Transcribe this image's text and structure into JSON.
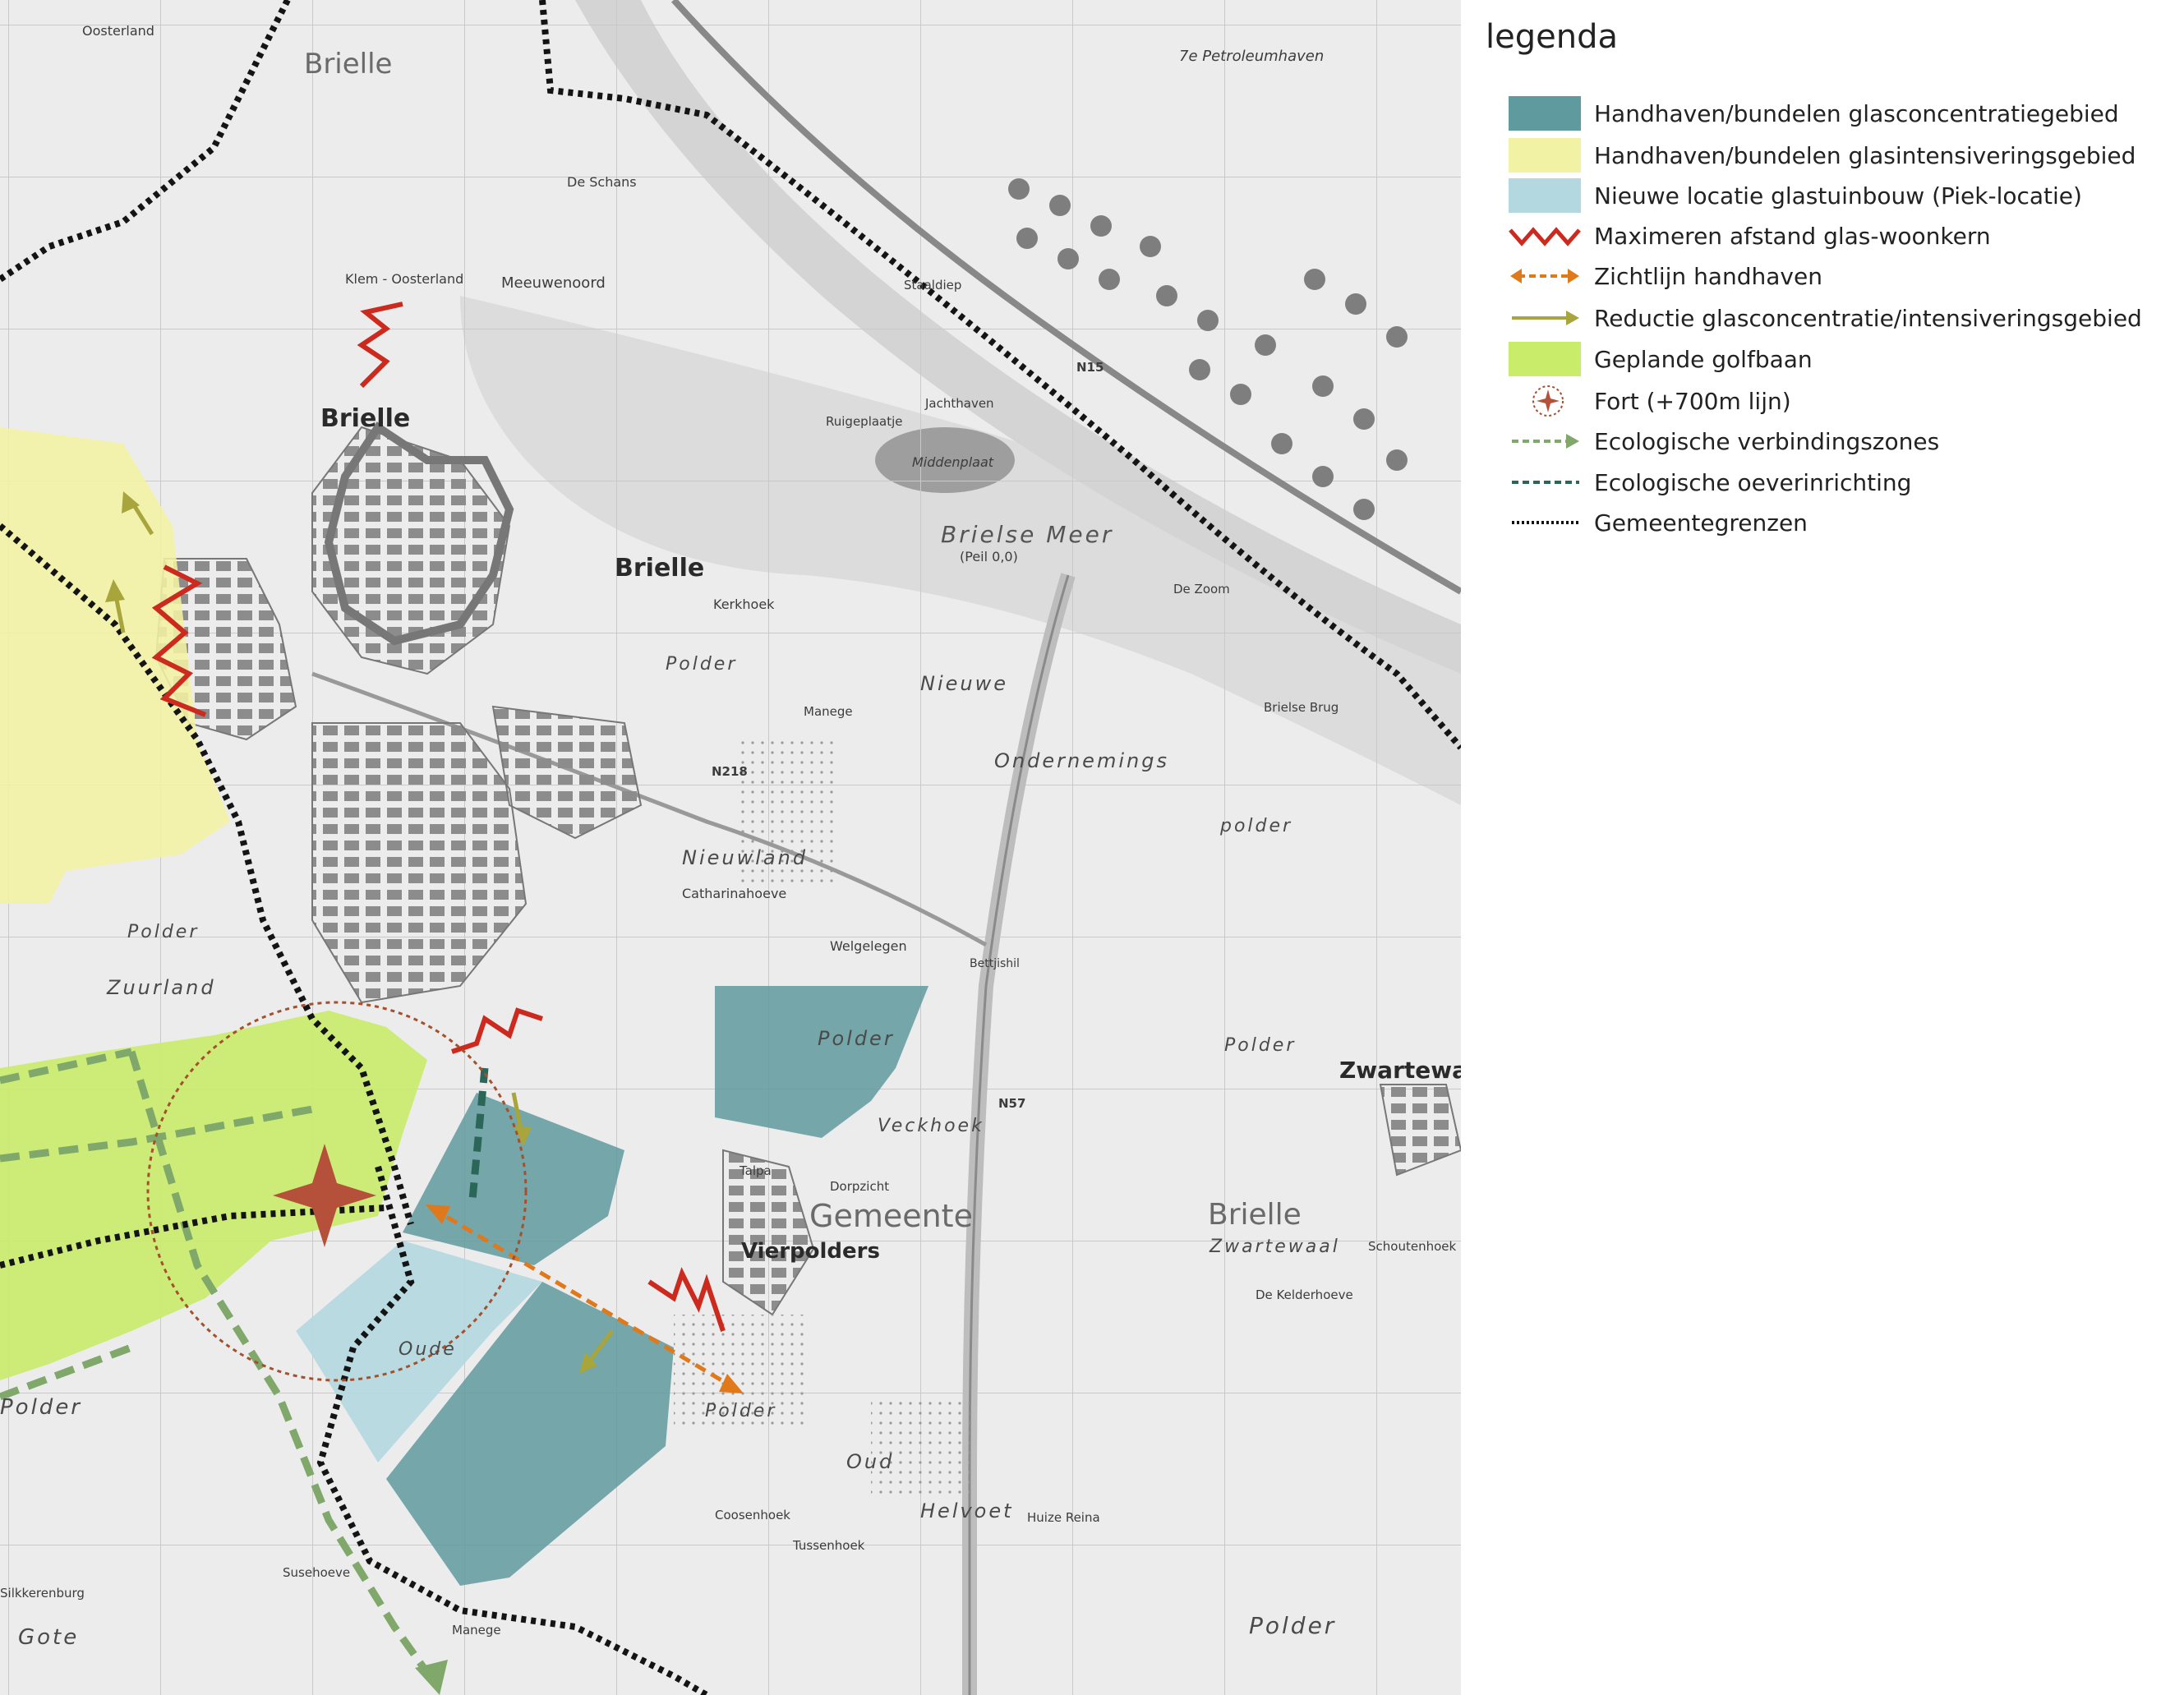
{
  "map": {
    "labels": {
      "brielle_main": "Brielle",
      "brielle_north": "Brielle",
      "brielle_nw": "Brielle",
      "brielle_se": "Brielle",
      "zwartewaal_town": "Zwartewaa",
      "vierpolders": "Vierpolders",
      "gemeente": "Gemeente",
      "brielse_meer": "Brielse Meer",
      "peil": "(Peil 0,0)",
      "middenplaat": "Middenplaat",
      "petroleumhaven": "7e Petroleumhaven",
      "nieuwe": "Nieuwe",
      "ondernemings": "Ondernemings",
      "polder_oe": "polder",
      "nieuwland": "Nieuwland",
      "polder_centre": "Polder",
      "polder_vierpolders": "Polder",
      "polder_west": "Polder",
      "polder_sw": "Polder",
      "polder_south": "Polder",
      "polder_se": "Polder",
      "groene_polder": "Polder",
      "zuurland": "Zuurland",
      "zwartewaal_area": "Zwartewaal",
      "veckhoek": "Veckhoek",
      "oud": "Oud",
      "helvoet": "Helvoet",
      "gote": "Gote",
      "oude": "Oude",
      "kerkhoek": "Kerkhoek",
      "meeuwenoord": "Meeuwenoord",
      "klem_oosterland": "Klem - Oosterland",
      "oosterland": "Oosterland",
      "de_schans": "De Schans",
      "catharinahoeve": "Catharinahoeve",
      "welgelegen": "Welgelegen",
      "coosenhoek": "Coosenhoek",
      "tussenhoek": "Tussenhoek",
      "huize_reina": "Huize Reina",
      "schoutenhoek": "Schoutenhoek",
      "de_kelderhoeve": "De Kelderhoeve",
      "manege_south": "Manege",
      "manege_north": "Manege",
      "dorpzicht": "Dorpzicht",
      "talpa": "Talpa",
      "sussehoeve": "Susehoeve",
      "silkkerenburg": "Silkkerenburg",
      "ruigeplaatje": "Ruigeplaatje",
      "jachthaven": "Jachthaven",
      "staaldiep": "Staaldiep",
      "brielse_brug": "Brielse Brug",
      "de_zoom": "De Zoom",
      "bettjishil": "Bettjishil",
      "road_n218": "N218",
      "road_n57": "N57",
      "road_n15": "N15"
    }
  },
  "legend": {
    "title": "legenda",
    "items": [
      {
        "label": "Handhaven/bundelen glasconcentratiegebied",
        "symbol": "fill-dark-teal",
        "color": "#5f9a9f"
      },
      {
        "label": "Handhaven/bundelen glasintensiveringsgebied",
        "symbol": "fill-pale-yellow",
        "color": "#f2f2a4"
      },
      {
        "label": "Nieuwe locatie glastuinbouw (Piek-locatie)",
        "symbol": "fill-light-blue",
        "color": "#b3d8df"
      },
      {
        "label": "Maximeren afstand glas-woonkern",
        "symbol": "red-zigzag-line",
        "color": "#cc2a1e"
      },
      {
        "label": "Zichtlijn handhaven",
        "symbol": "orange-dashed-double-arrow",
        "color": "#e0781c"
      },
      {
        "label": "Reductie glasconcentratie/intensiveringsgebied",
        "symbol": "olive-arrow",
        "color": "#a7a53c"
      },
      {
        "label": "Geplande golfbaan",
        "symbol": "fill-lime-green",
        "color": "#c9ec6a"
      },
      {
        "label": "Fort (+700m lijn)",
        "symbol": "fort-star-circle",
        "color": "#a5502c"
      },
      {
        "label": "Ecologische verbindingszones",
        "symbol": "green-dashed-arrow",
        "color": "#7fa86a"
      },
      {
        "label": "Ecologische oeverinrichting",
        "symbol": "dark-green-dashed-line",
        "color": "#2c6658"
      },
      {
        "label": "Gemeentegrenzen",
        "symbol": "black-dotted-line",
        "color": "#111111"
      }
    ]
  }
}
